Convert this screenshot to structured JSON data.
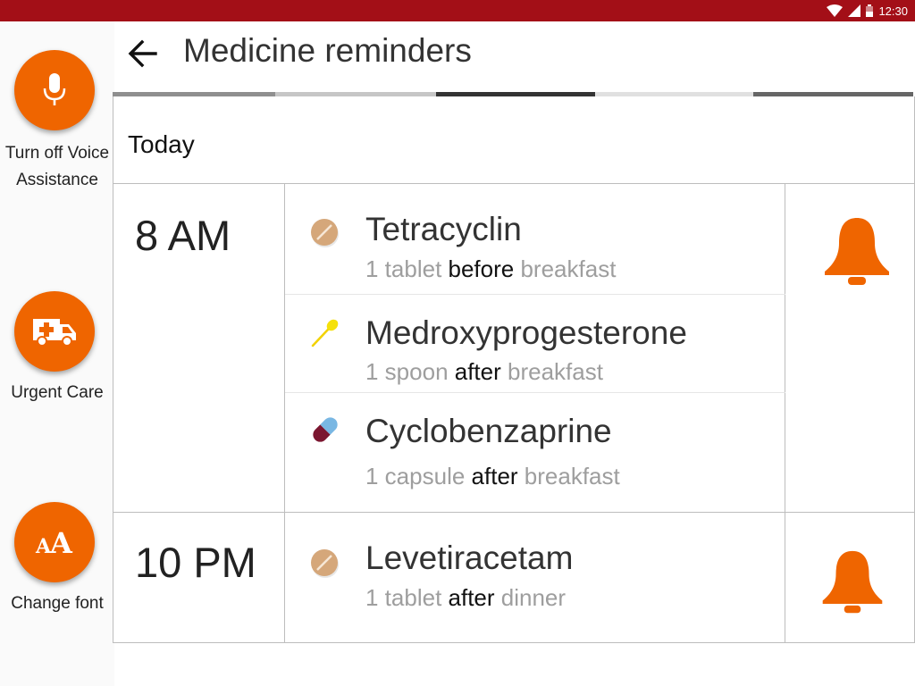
{
  "status_bar": {
    "time": "12:30"
  },
  "sidebar": {
    "voice_label": "Turn off Voice Assistance",
    "urgent_label": "Urgent Care",
    "font_label": "Change font"
  },
  "header": {
    "title": "Medicine reminders"
  },
  "tabs": [
    {
      "color": "#8f8f8f"
    },
    {
      "color": "#c6c6c6"
    },
    {
      "color": "#333333"
    },
    {
      "color": "#e0e0e0"
    },
    {
      "color": "#666666"
    }
  ],
  "day": {
    "label": "Today"
  },
  "colors": {
    "accent": "#ef6500",
    "status_bar": "#a30f17"
  },
  "schedule": [
    {
      "time": "8 AM",
      "medicines": [
        {
          "icon": "tablet-icon",
          "name": "Tetracyclin",
          "qty": "1  tablet",
          "relation": "before",
          "meal": "breakfast"
        },
        {
          "icon": "spoon-icon",
          "name": "Medroxyprogesterone",
          "qty": "1 spoon",
          "relation": "after",
          "meal": "breakfast"
        },
        {
          "icon": "capsule-icon",
          "name": "Cyclobenzaprine",
          "qty": "1 capsule",
          "relation": "after",
          "meal": "breakfast"
        }
      ]
    },
    {
      "time": "10 PM",
      "medicines": [
        {
          "icon": "tablet-icon",
          "name": "Levetiracetam",
          "qty": "1 tablet",
          "relation": "after",
          "meal": "dinner"
        }
      ]
    }
  ]
}
